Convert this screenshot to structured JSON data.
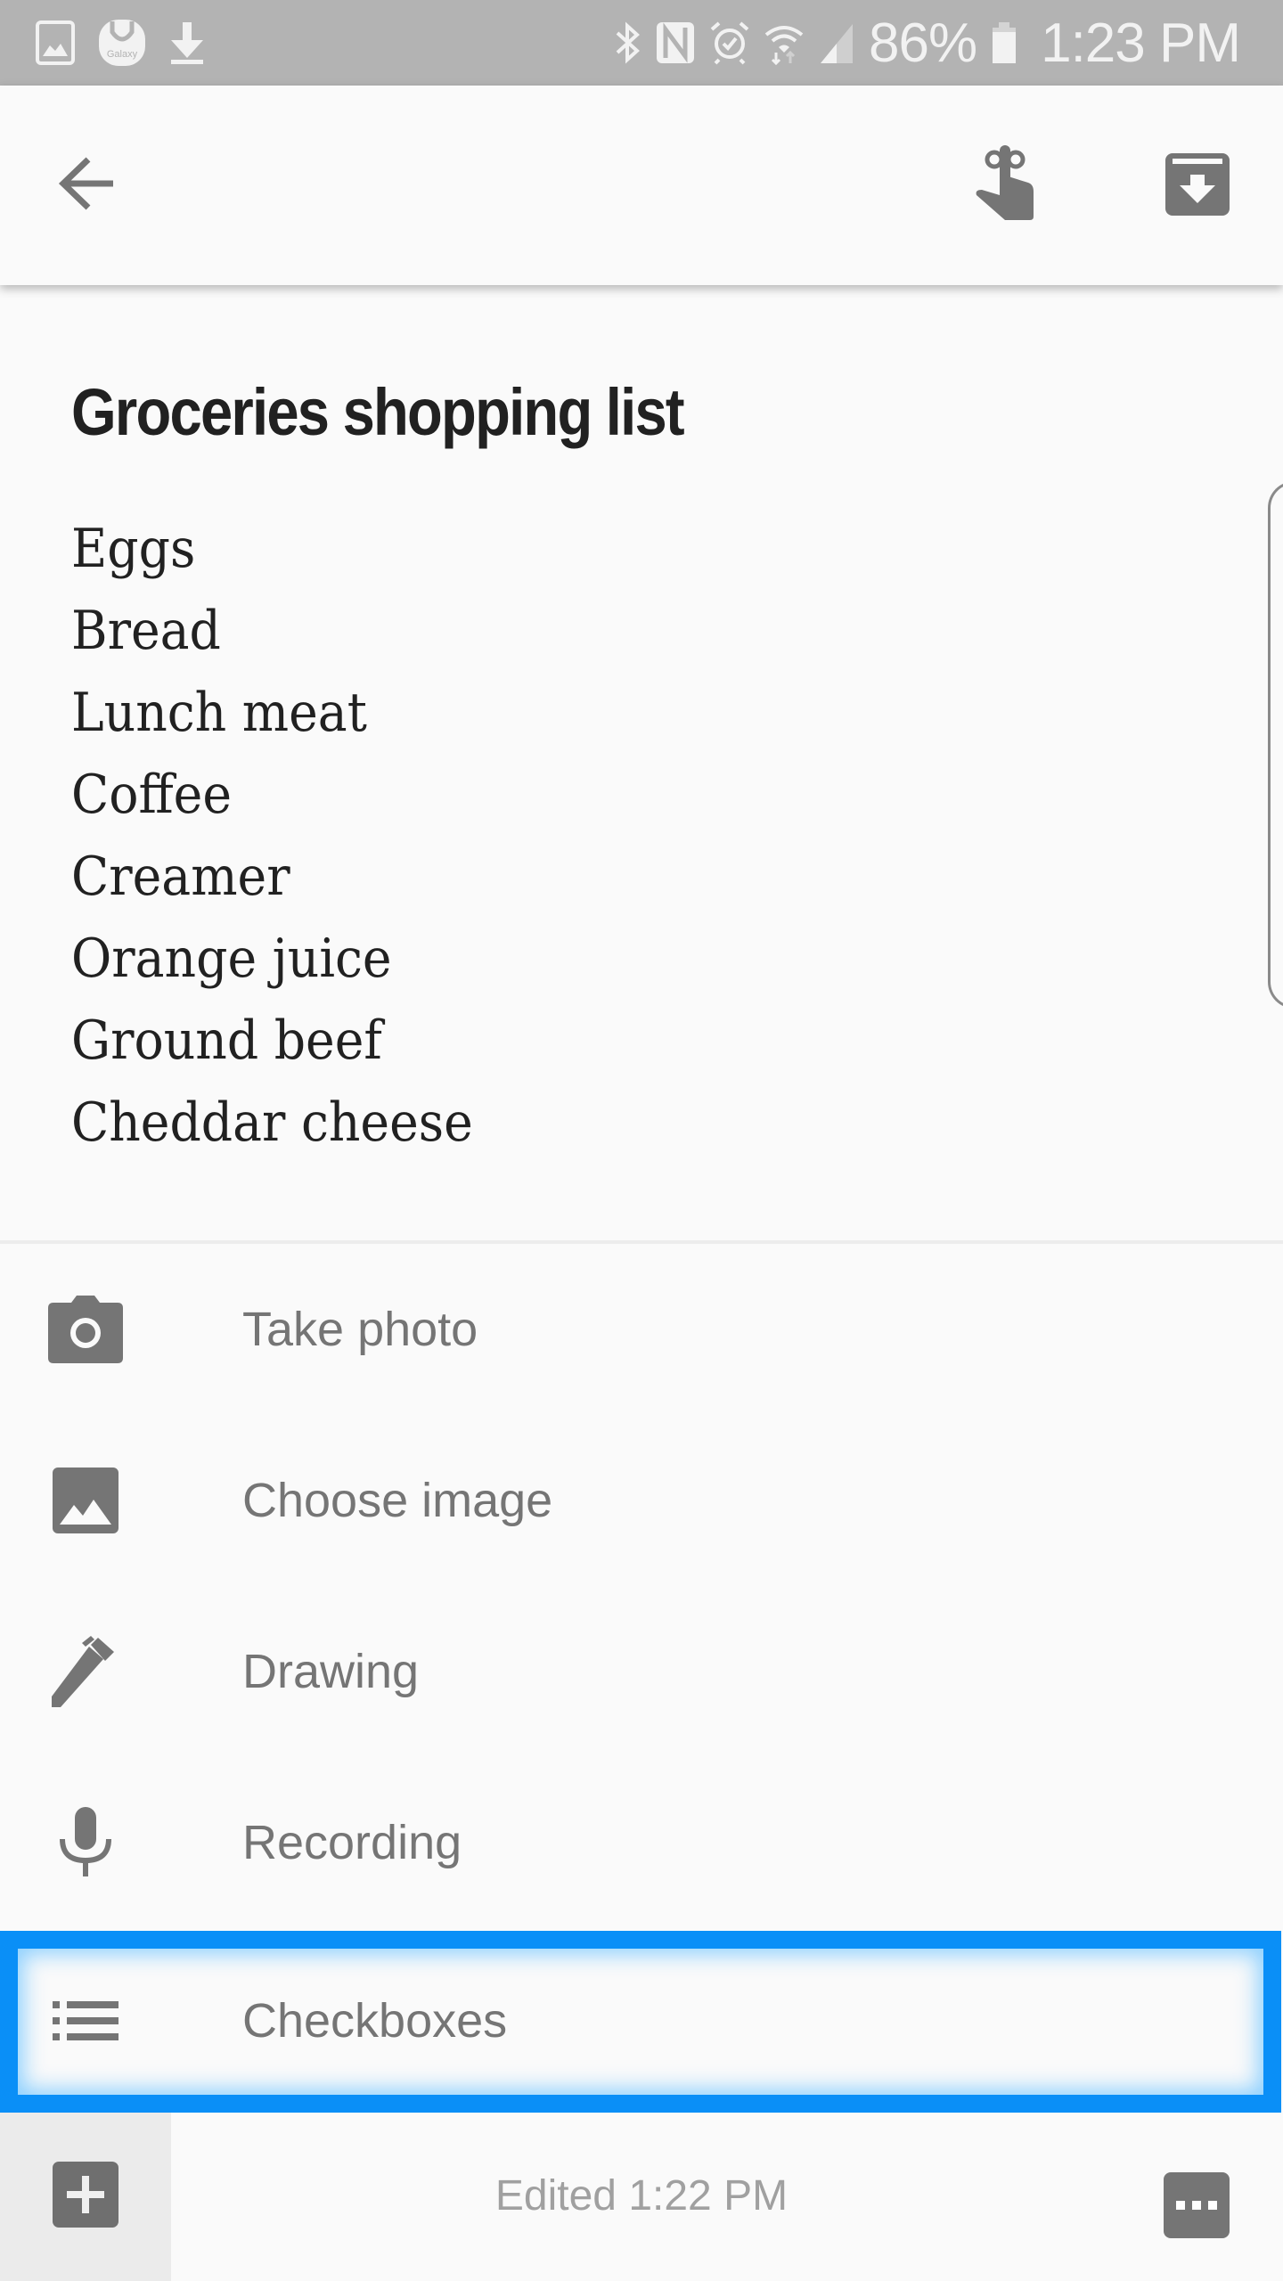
{
  "status_bar": {
    "notification_icons": [
      "gallery-icon",
      "galaxy-store-icon",
      "download-icon"
    ],
    "system_icons": [
      "bluetooth-icon",
      "nfc-icon",
      "alarm-icon",
      "wifi-icon",
      "signal-icon",
      "battery-icon"
    ],
    "galaxy_label": "Galaxy",
    "battery_percent": "86%",
    "time": "1:23 PM"
  },
  "toolbar": {
    "back_icon": "arrow-back-icon",
    "reminder_icon": "reminder-icon",
    "archive_icon": "archive-icon"
  },
  "note": {
    "title": "Groceries shopping list",
    "items": [
      "Eggs",
      "Bread",
      "Lunch meat",
      "Coffee",
      "Creamer",
      "Orange juice",
      "Ground beef",
      "Cheddar cheese"
    ]
  },
  "add_menu": {
    "items": [
      {
        "label": "Take photo",
        "icon": "camera-icon"
      },
      {
        "label": "Choose image",
        "icon": "image-icon"
      },
      {
        "label": "Drawing",
        "icon": "pen-icon"
      },
      {
        "label": "Recording",
        "icon": "microphone-icon"
      },
      {
        "label": "Checkboxes",
        "icon": "list-icon",
        "highlighted": true
      }
    ],
    "highlight_color": "#0a8ff7"
  },
  "bottom_bar": {
    "add_icon": "plus-box-icon",
    "edited_text": "Edited 1:22 PM",
    "more_icon": "more-horizontal-icon"
  },
  "colors": {
    "status_bar_bg": "#b3b3b3",
    "icon_gray": "#757575",
    "text_dark": "#212121",
    "text_muted": "#757575"
  }
}
